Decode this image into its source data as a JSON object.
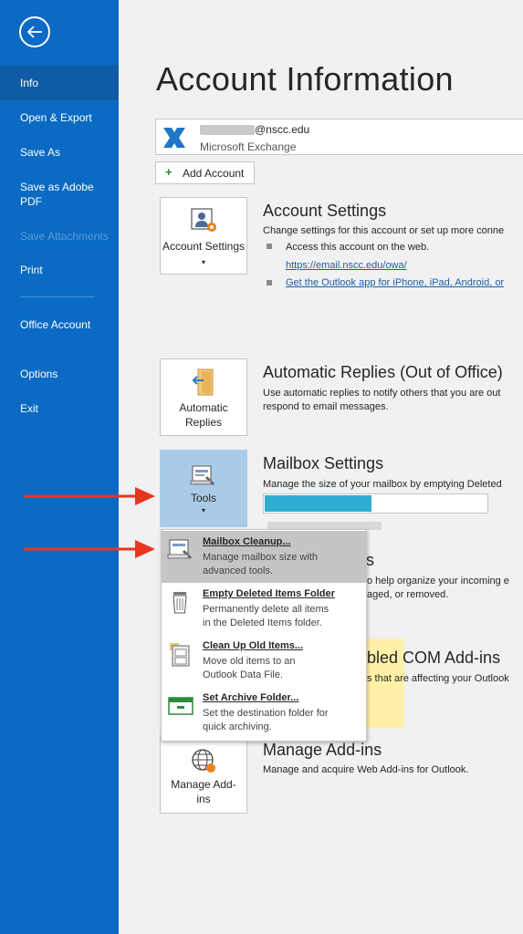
{
  "sidebar": {
    "items": [
      {
        "label": "Info",
        "active": true
      },
      {
        "label": "Open & Export"
      },
      {
        "label": "Save As"
      },
      {
        "label": "Save as Adobe PDF"
      },
      {
        "label": "Save Attachments",
        "disabled": true
      },
      {
        "label": "Print"
      },
      {
        "label": "Office Account"
      },
      {
        "label": "Options"
      },
      {
        "label": "Exit"
      }
    ]
  },
  "page": {
    "title": "Account Information"
  },
  "account": {
    "email": "@nscc.edu",
    "type": "Microsoft Exchange",
    "add_label": "Add Account"
  },
  "account_settings": {
    "tile_label": "Account Settings",
    "title": "Account Settings",
    "desc": "Change settings for this account or set up more conne",
    "bullet1": "Access this account on the web.",
    "link1": "https://email.nscc.edu/owa/",
    "link2": "Get the Outlook app for iPhone, iPad, Android, or"
  },
  "auto_replies": {
    "tile_label_1": "Automatic",
    "tile_label_2": "Replies",
    "title": "Automatic Replies (Out of Office)",
    "desc_1": "Use automatic replies to notify others that you are out",
    "desc_2": "respond to email messages."
  },
  "mailbox": {
    "tile_label": "Tools",
    "title": "Mailbox Settings",
    "desc": "Manage the size of your mailbox by emptying Deleted",
    "usage_fraction": 0.48
  },
  "rules_partial": {
    "title": "rts",
    "desc_1": "o help organize your incoming e",
    "desc_2": "aged, or removed."
  },
  "com_addins_partial": {
    "title": "bled COM Add-ins",
    "desc": "s that are affecting your Outlook"
  },
  "manage_addins": {
    "tile_label_1": "Manage Add-",
    "tile_label_2": "ins",
    "title": "Manage Add-ins",
    "desc": "Manage and acquire Web Add-ins for Outlook."
  },
  "tools_menu": [
    {
      "title": "Mailbox Cleanup...",
      "desc_1": "Manage mailbox size with",
      "desc_2": "advanced tools.",
      "icon": "mailbox-cleanup-icon"
    },
    {
      "title": "Empty Deleted Items Folder",
      "desc_1": "Permanently delete all items",
      "desc_2": "in the Deleted Items folder.",
      "icon": "trash-icon"
    },
    {
      "title": "Clean Up Old Items...",
      "desc_1": "Move old items to an",
      "desc_2": "Outlook Data File.",
      "icon": "archive-cabinet-icon"
    },
    {
      "title": "Set Archive Folder...",
      "desc_1": "Set the destination folder for",
      "desc_2": "quick archiving.",
      "icon": "archive-folder-icon"
    }
  ],
  "colors": {
    "sidebar": "#0a6ac4",
    "accent_arrow": "#e8351f",
    "usage_fill": "#2eaed3"
  }
}
